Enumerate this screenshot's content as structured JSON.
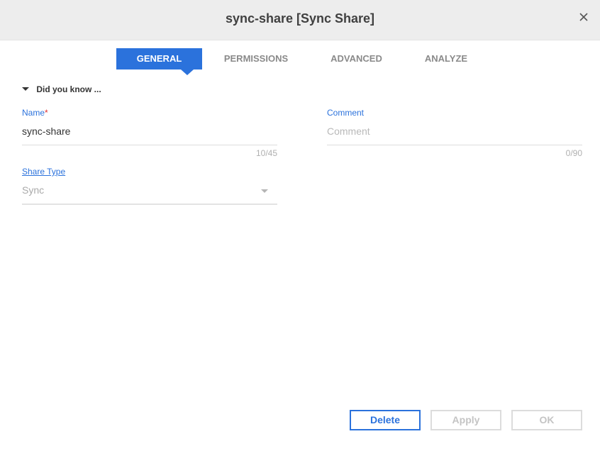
{
  "dialog": {
    "title": "sync-share [Sync Share]"
  },
  "tabs": [
    {
      "label": "GENERAL",
      "active": true
    },
    {
      "label": "PERMISSIONS",
      "active": false
    },
    {
      "label": "ADVANCED",
      "active": false
    },
    {
      "label": "ANALYZE",
      "active": false
    }
  ],
  "did_you_know": {
    "label": "Did you know ..."
  },
  "form": {
    "name": {
      "label": "Name",
      "required_mark": "*",
      "value": "sync-share",
      "counter": "10/45"
    },
    "comment": {
      "label": "Comment",
      "placeholder": "Comment",
      "value": "",
      "counter": "0/90"
    },
    "share_type": {
      "label": "Share Type",
      "value": "Sync"
    }
  },
  "buttons": {
    "delete": "Delete",
    "apply": "Apply",
    "ok": "OK"
  },
  "colors": {
    "accent": "#2b72dc",
    "required": "#e03030",
    "disabled": "#c4c4c4"
  },
  "icons": {
    "close": "close-icon",
    "collapse": "caret-down-icon",
    "dropdown": "chevron-down-icon"
  }
}
